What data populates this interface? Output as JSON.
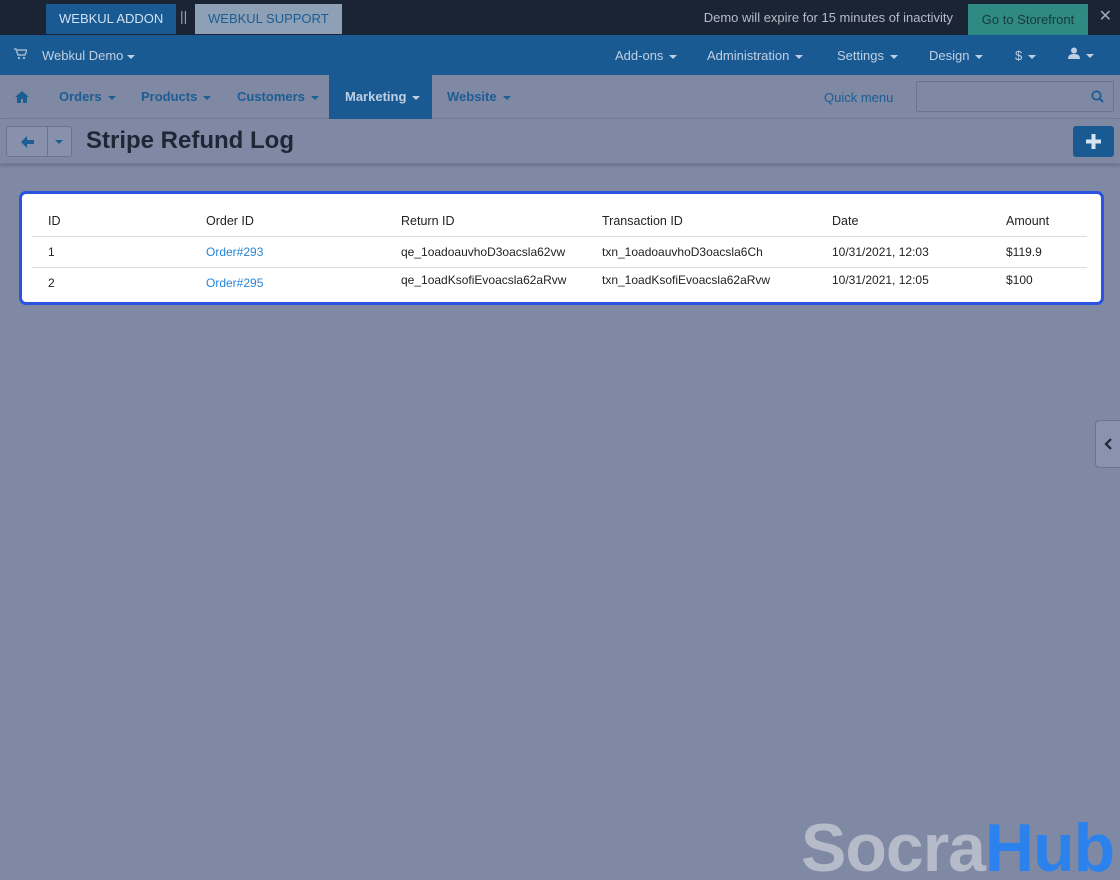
{
  "demo_bar": {
    "addon_label": "WEBKUL ADDON",
    "separator": "||",
    "support_label": "WEBKUL SUPPORT",
    "notice": "Demo will expire for 15 minutes of inactivity",
    "storefront_label": "Go to Storefront",
    "close_label": "✕"
  },
  "top_nav": {
    "company": "Webkul Demo",
    "items": [
      "Add-ons",
      "Administration",
      "Settings",
      "Design",
      "$"
    ]
  },
  "main_nav": {
    "items": [
      "Orders",
      "Products",
      "Customers",
      "Marketing",
      "Website"
    ],
    "active": "Marketing",
    "quick_menu": "Quick menu",
    "search_placeholder": ""
  },
  "toolbar": {
    "title": "Stripe Refund Log"
  },
  "table": {
    "headers": [
      "ID",
      "Order ID",
      "Return ID",
      "Transaction ID",
      "Date",
      "Amount"
    ],
    "rows": [
      [
        "1",
        "Order#293",
        "qe_1oadoauvhoD3oacsla62vw",
        "txn_1oadoauvhoD3oacsla6Ch",
        "10/31/2021, 12:03",
        "$119.9"
      ],
      [
        "2",
        "Order#295",
        "qe_1oadKsofiEvoacsla62aRvw",
        "txn_1oadKsofiEvoacsla62aRvw",
        "10/31/2021, 12:05",
        "$100"
      ]
    ]
  },
  "watermark": {
    "part1": "Socra",
    "part2": "Hub"
  },
  "colors": {
    "header_dark": "#1a2434",
    "nav_blue": "#1a5a93",
    "link": "#2585d9",
    "highlight_border": "#2a54e0",
    "storefront_teal": "#2f8a84"
  }
}
